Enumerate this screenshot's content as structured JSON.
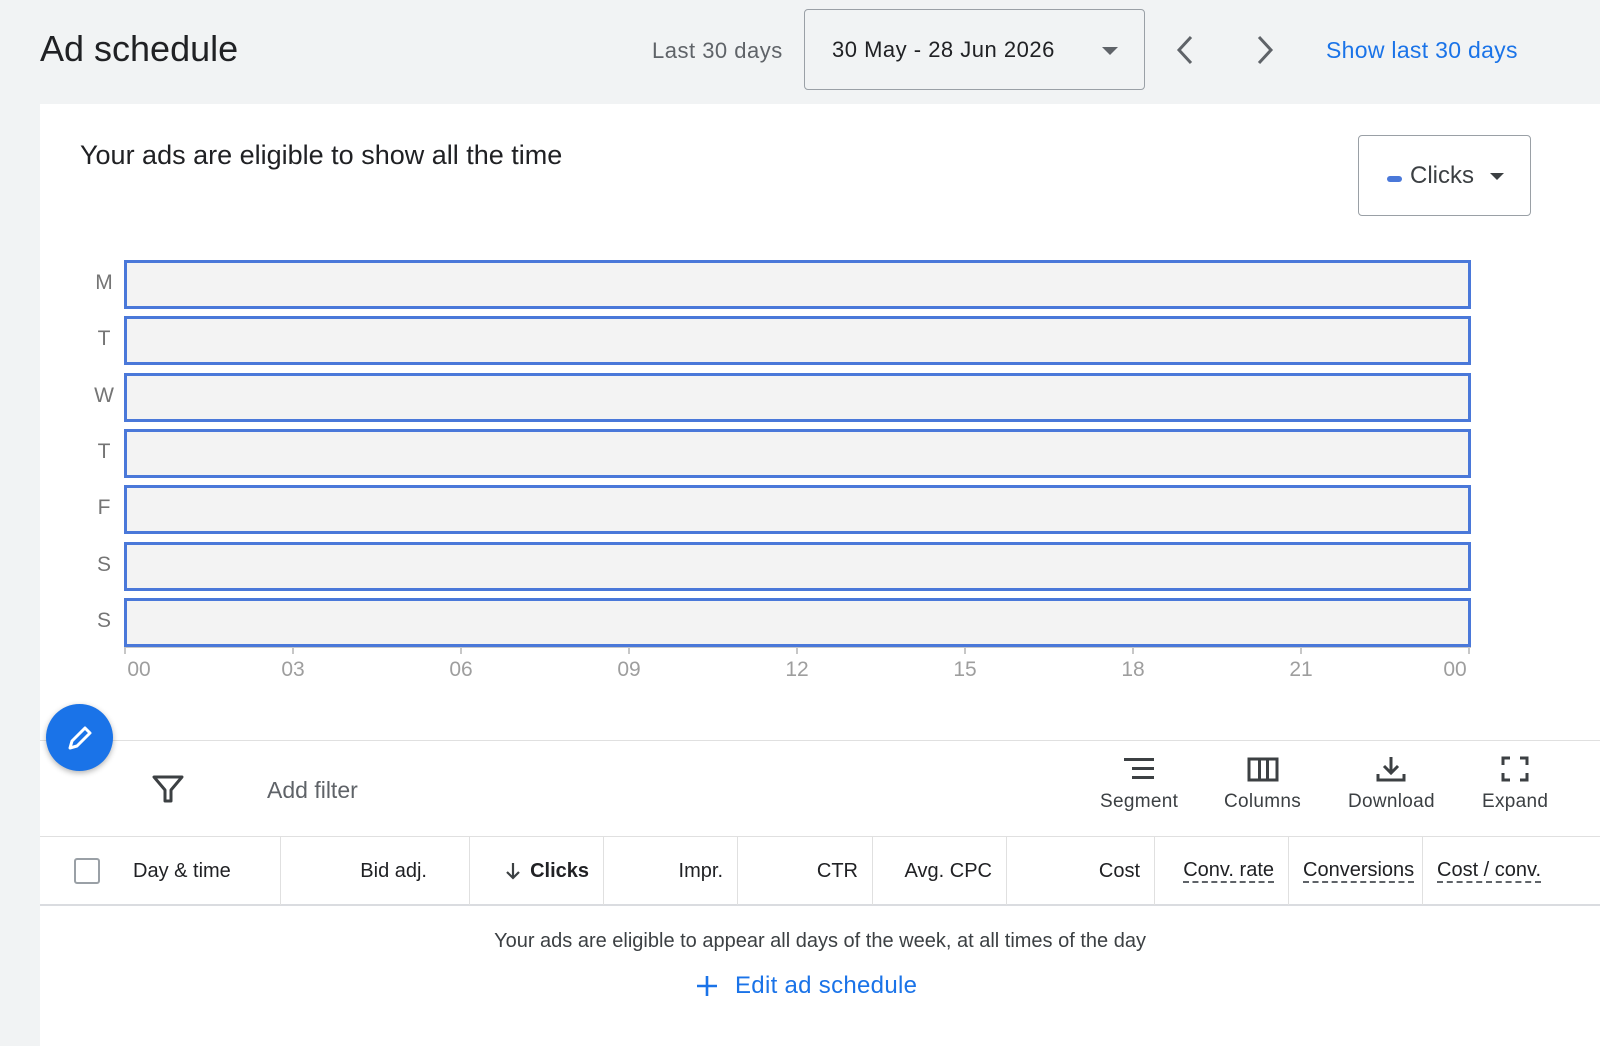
{
  "header": {
    "title": "Ad schedule",
    "range_label": "Last 30 days",
    "date_range": "30 May - 28 Jun 2026",
    "show_last_link": "Show last 30 days"
  },
  "chart_card": {
    "title": "Your ads are eligible to show all the time",
    "metric_selected": "Clicks",
    "metric_color": "#4a78d9"
  },
  "chart_data": {
    "type": "heatmap",
    "rows": [
      "M",
      "T",
      "W",
      "T",
      "F",
      "S",
      "S"
    ],
    "x_ticks": [
      "00",
      "03",
      "06",
      "09",
      "12",
      "15",
      "18",
      "21",
      "00"
    ],
    "schedule": "all days, all hours"
  },
  "toolbar": {
    "add_filter": "Add filter",
    "segment": "Segment",
    "columns": "Columns",
    "download": "Download",
    "expand": "Expand"
  },
  "table": {
    "columns": [
      "Day & time",
      "Bid adj.",
      "Clicks",
      "Impr.",
      "CTR",
      "Avg. CPC",
      "Cost",
      "Conv. rate",
      "Conversions",
      "Cost / conv."
    ],
    "sort_column": "Clicks",
    "empty_message": "Your ads are eligible to appear all days of the week, at all times of the day",
    "edit_link": "Edit ad schedule"
  }
}
